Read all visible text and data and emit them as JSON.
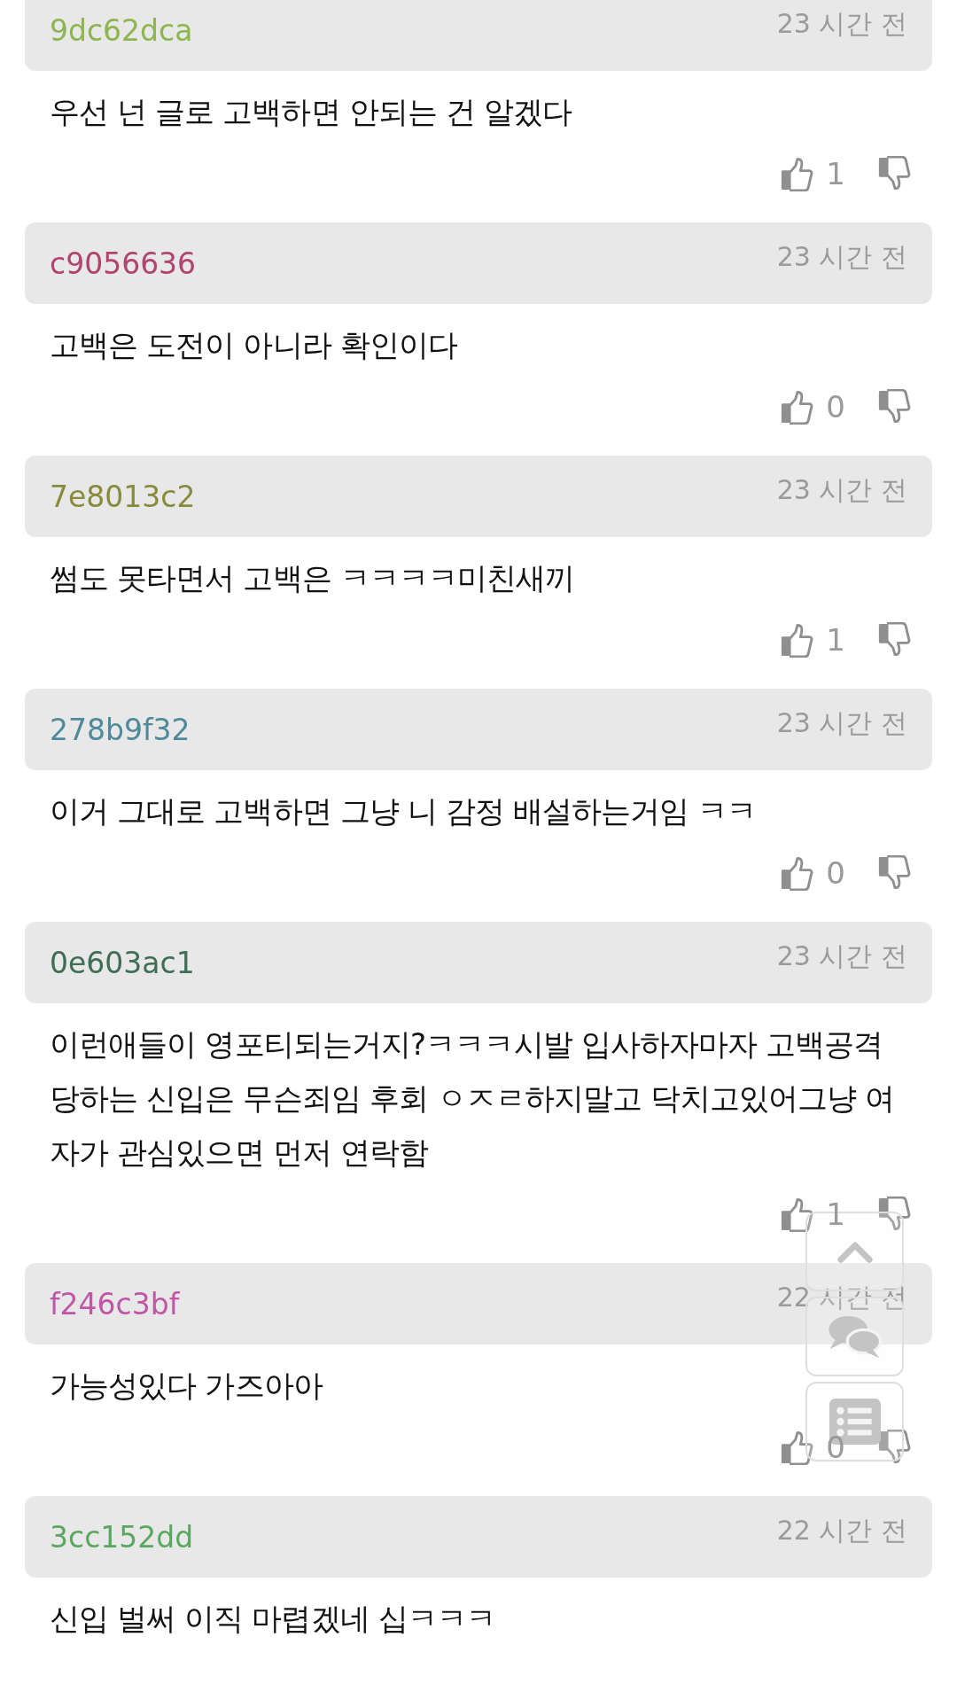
{
  "comments": [
    {
      "user": "9dc62dca",
      "color": "#8db550",
      "time": "23 시간 전",
      "text": "우선 넌 글로 고백하면 안되는 건 알겠다",
      "likes": "1"
    },
    {
      "user": "c9056636",
      "color": "#b0446e",
      "time": "23 시간 전",
      "text": "고백은 도전이 아니라 확인이다",
      "likes": "0"
    },
    {
      "user": "7e8013c2",
      "color": "#8a8a3c",
      "time": "23 시간 전",
      "text": "썸도 못타면서 고백은 ㅋㅋㅋㅋ미친새끼",
      "likes": "1"
    },
    {
      "user": "278b9f32",
      "color": "#4e8a9a",
      "time": "23 시간 전",
      "text": "이거 그대로 고백하면 그냥 니 감정 배설하는거임 ㅋㅋ",
      "likes": "0"
    },
    {
      "user": "0e603ac1",
      "color": "#3f6e55",
      "time": "23 시간 전",
      "text": "이런애들이 영포티되는거지?ㅋㅋㅋ시발 입사하자마자 고백공격 당하는 신입은 무슨죄임 후회 ㅇㅈㄹ하지말고 닥치고있어그냥 여자가 관심있으면 먼저 연락함",
      "likes": "1"
    },
    {
      "user": "f246c3bf",
      "color": "#c056a8",
      "time": "22 시간 전",
      "text": "가능성있다 가즈아아",
      "likes": "0"
    },
    {
      "user": "3cc152dd",
      "color": "#5aa860",
      "time": "22 시간 전",
      "text": "신입 벌써 이직 마렵겠네 십ㅋㅋㅋ"
    }
  ]
}
